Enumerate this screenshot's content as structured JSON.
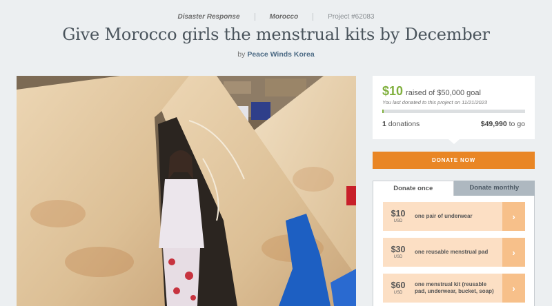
{
  "breadcrumb": {
    "category": "Disaster Response",
    "country": "Morocco",
    "project_id": "Project #62083"
  },
  "title": "Give Morocco girls the menstrual kits by December",
  "byline": {
    "prefix": "by",
    "org": "Peace Winds Korea"
  },
  "progress": {
    "raised": "$10",
    "raised_text": "raised of $50,000 goal",
    "last_donated": "You last donated to this project on 11/21/2023",
    "fraction": 0.0002,
    "donations_count": "1",
    "donations_label": "donations",
    "to_go_amount": "$49,990",
    "to_go_label": "to go",
    "accent_color": "#80b03e"
  },
  "donate_button": "DONATE NOW",
  "tabs": [
    {
      "label": "Donate once",
      "active": true
    },
    {
      "label": "Donate monthly",
      "active": false
    }
  ],
  "options": [
    {
      "price": "$10",
      "currency": "USD",
      "desc": "one pair of underwear",
      "icon": "chevron-right-icon"
    },
    {
      "price": "$30",
      "currency": "USD",
      "desc": "one reusable menstrual pad",
      "icon": "chevron-right-icon"
    },
    {
      "price": "$60",
      "currency": "USD",
      "desc": "one menstrual kit (reusable pad, underwear, bucket, soap)",
      "icon": "chevron-right-icon"
    }
  ],
  "colors": {
    "donate": "#e98625",
    "option_bg": "#fcdfc4",
    "option_arrow": "#f7c08a"
  }
}
